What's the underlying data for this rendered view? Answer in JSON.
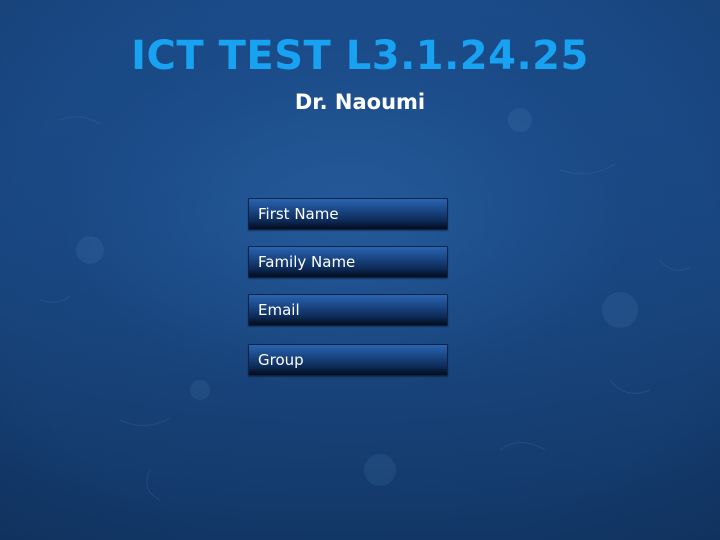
{
  "header": {
    "title": "ICT TEST L3.1.24.25",
    "subtitle": "Dr. Naoumi"
  },
  "form": {
    "first_name": {
      "placeholder": "First Name",
      "value": ""
    },
    "family_name": {
      "placeholder": "Family Name",
      "value": ""
    },
    "email": {
      "placeholder": "Email",
      "value": ""
    },
    "group": {
      "placeholder": "Group",
      "value": ""
    }
  },
  "colors": {
    "title": "#18a3f2",
    "subtitle": "#ffffff",
    "background": "#17427a",
    "field_top": "#2a63b0",
    "field_bottom": "#030b1b"
  }
}
